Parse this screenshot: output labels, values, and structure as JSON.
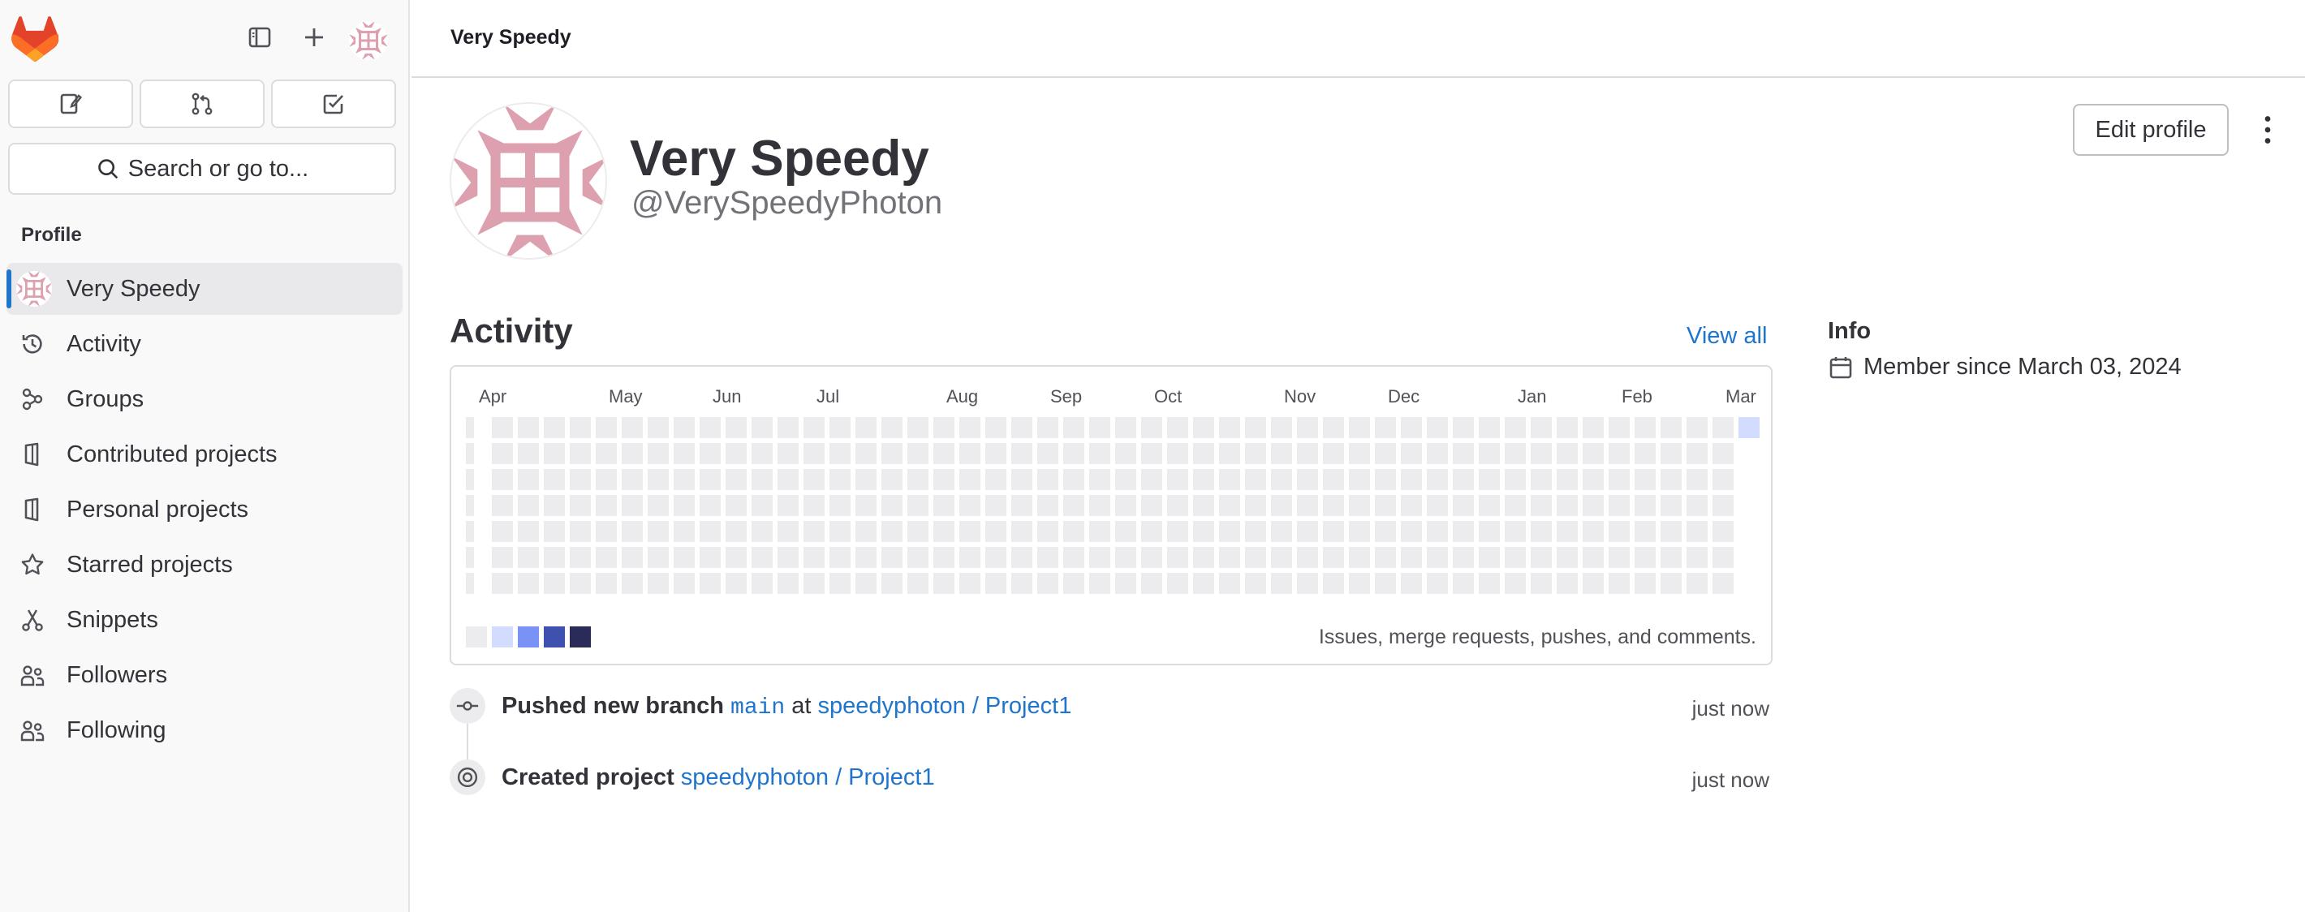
{
  "breadcrumb": "Very Speedy",
  "search": {
    "label": "Search or go to..."
  },
  "sidebar": {
    "section_title": "Profile",
    "items": [
      {
        "label": "Very Speedy",
        "icon": "avatar",
        "active": true
      },
      {
        "label": "Activity",
        "icon": "history-icon"
      },
      {
        "label": "Groups",
        "icon": "group-icon"
      },
      {
        "label": "Contributed projects",
        "icon": "project-icon"
      },
      {
        "label": "Personal projects",
        "icon": "project-icon"
      },
      {
        "label": "Starred projects",
        "icon": "star-icon"
      },
      {
        "label": "Snippets",
        "icon": "snippet-icon"
      },
      {
        "label": "Followers",
        "icon": "users-icon"
      },
      {
        "label": "Following",
        "icon": "users-icon"
      }
    ]
  },
  "profile": {
    "name": "Very Speedy",
    "handle": "@VerySpeedyPhoton",
    "edit_label": "Edit profile"
  },
  "activity": {
    "title": "Activity",
    "view_all": "View all",
    "months": [
      "Apr",
      "May",
      "Jun",
      "Jul",
      "Aug",
      "Sep",
      "Oct",
      "Nov",
      "Dec",
      "Jan",
      "Feb",
      "Mar"
    ],
    "legend_text": "Issues, merge requests, pushes, and comments.",
    "legend_colors": [
      "#ececef",
      "#d2dcff",
      "#7992f5",
      "#3f51ae",
      "#2a2b59"
    ],
    "active_days": [
      {
        "week": 49,
        "day": 0,
        "level": 1
      }
    ]
  },
  "info": {
    "title": "Info",
    "member_since": "Member since March 03, 2024"
  },
  "events": [
    {
      "action": "Pushed new branch",
      "branch": "main",
      "connector": "at",
      "project": "speedyphoton / Project1",
      "time": "just now"
    },
    {
      "action": "Created project",
      "project": "speedyphoton / Project1",
      "time": "just now"
    }
  ],
  "colors": {
    "accent": "#1f75cb",
    "avatar_pink": "#dda0ae",
    "gitlab_orange": "#fc6d26"
  }
}
